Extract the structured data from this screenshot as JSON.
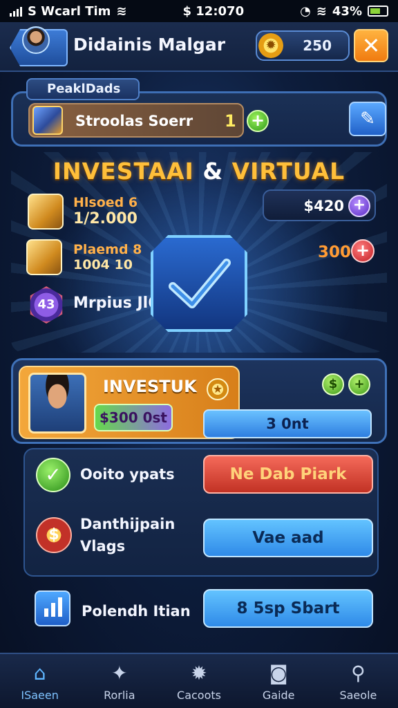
{
  "status_bar": {
    "carrier": "S Wcarl Tim",
    "time": "$ 12:070",
    "battery": "43%"
  },
  "header": {
    "player_name": "Didainis Malgar",
    "coins": "250"
  },
  "products": {
    "section_label": "PeaklDads",
    "item_label": "Stroolas Soerr",
    "item_count": "1"
  },
  "investment": {
    "title_left": "INVESTAAI",
    "title_amp": "&",
    "title_right": "VIRTUAL",
    "items": [
      {
        "line1": "Hlsoed 6",
        "line2": "1/2.000"
      },
      {
        "line1": "Plaemd 8",
        "line2": "1004 10"
      }
    ],
    "value_pill": "$420",
    "value_red": "300",
    "mrpius_label": "Mrpius Jl60m",
    "hex_badge": "43"
  },
  "profile": {
    "name": "INVESTUK",
    "money": "$300 0st",
    "button_value": "3 0nt"
  },
  "actions": [
    {
      "label": "Ooito ypats",
      "button": "Ne Dab Piark",
      "style": "red"
    },
    {
      "label_line1": "Danthijpain",
      "label_line2": "Vlags",
      "button": "Vae aad",
      "style": "blue"
    },
    {
      "label": "Polendh Itian",
      "button": "8 5sp Sbart",
      "style": "blue"
    }
  ],
  "bottom_nav": [
    {
      "label": "ISaeen",
      "icon": "home-icon",
      "glyph": "⌂",
      "active": true
    },
    {
      "label": "Rorlia",
      "icon": "tools-icon",
      "glyph": "✦",
      "active": false
    },
    {
      "label": "Cacoots",
      "icon": "gear-icon",
      "glyph": "✹",
      "active": false
    },
    {
      "label": "Gaide",
      "icon": "camera-icon",
      "glyph": "◙",
      "active": false
    },
    {
      "label": "Saeole",
      "icon": "search-icon",
      "glyph": "⚲",
      "active": false
    }
  ],
  "colors": {
    "accent_orange": "#ffbf3a",
    "accent_blue": "#2e7ee0",
    "accent_red": "#c23224",
    "accent_green": "#2e9a1a"
  }
}
